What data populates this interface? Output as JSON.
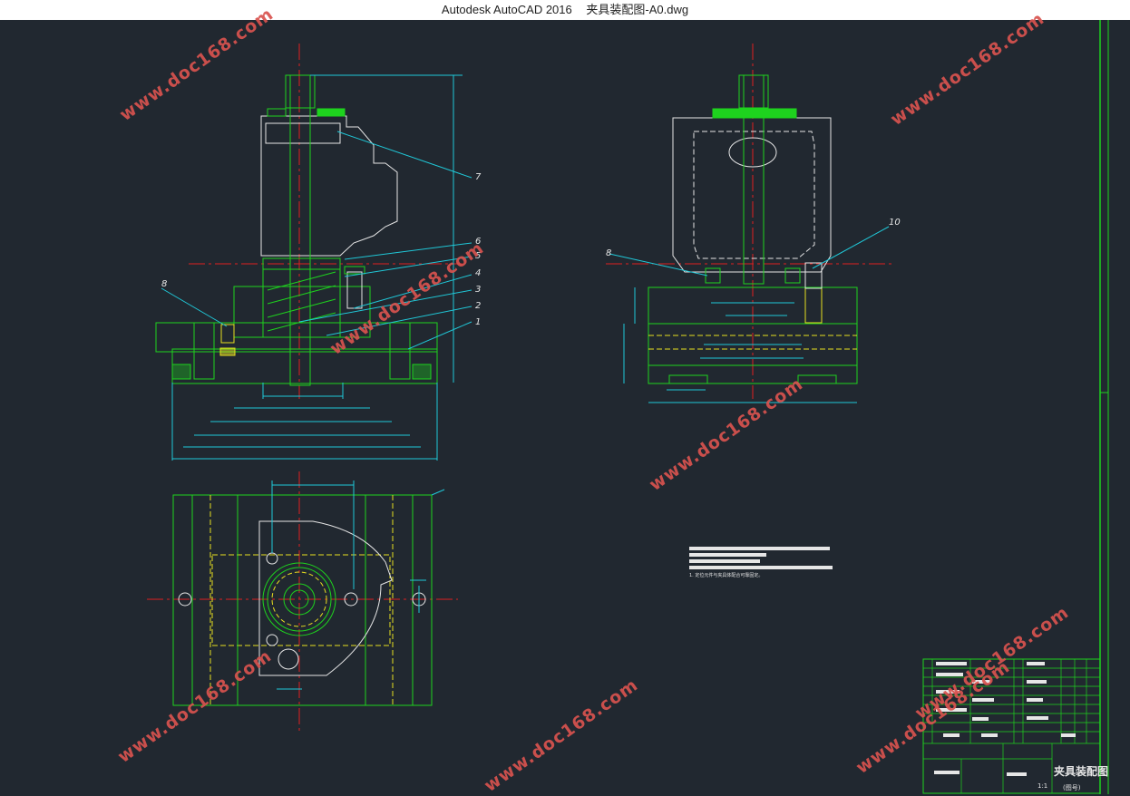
{
  "window": {
    "app_title": "Autodesk AutoCAD 2016",
    "document_title": "夹具装配图-A0.dwg"
  },
  "drawing": {
    "balloons": {
      "front_view": [
        "7",
        "6",
        "5",
        "4",
        "3",
        "2",
        "1",
        "8"
      ],
      "side_view": [
        "8",
        "10"
      ]
    },
    "tech_requirements_note": "1. 定位元件与夹具体配合可靠固定。",
    "title_block": {
      "drawing_name": "夹具装配图",
      "sub_label": "(图号)",
      "scale": "1:1"
    }
  },
  "watermarks": [
    "www.doc168.com",
    "www.doc168.com",
    "www.doc168.com",
    "www.doc168.com",
    "www.doc168.com",
    "www.doc168.com",
    "www.doc168.com",
    "www.doc168.com"
  ],
  "colors": {
    "background": "#212830",
    "part_green": "#1ed31e",
    "dim_cyan": "#20c8d8",
    "center_red": "#e02020",
    "outline_white": "#e6e6e6",
    "hidden_yellow": "#e8e020",
    "watermark": "#d9534f"
  }
}
